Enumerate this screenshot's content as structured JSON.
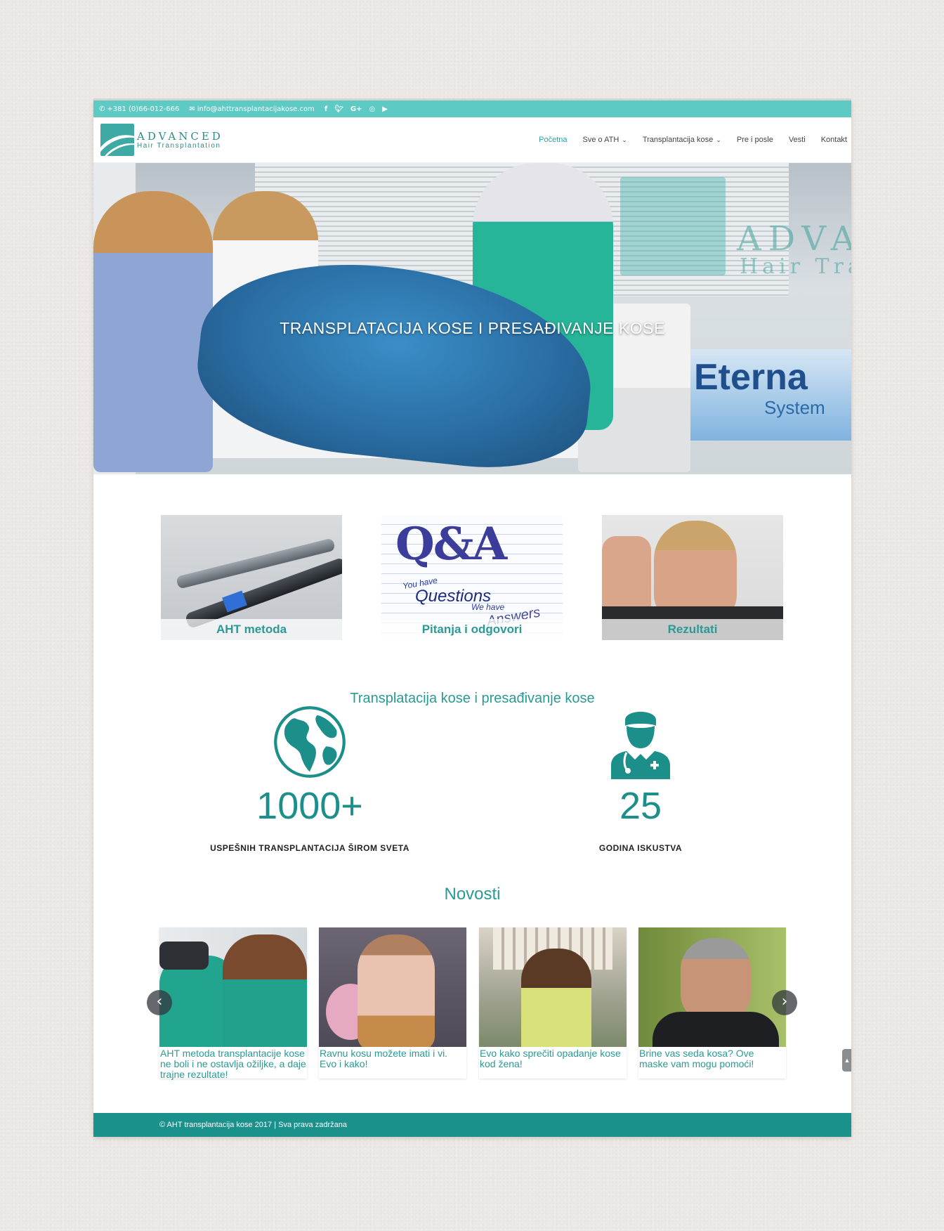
{
  "topbar": {
    "phone": "+381 (0)66-012-666",
    "email": "info@ahttransplantacijakose.com",
    "social": [
      "facebook-icon",
      "twitter-icon",
      "google-plus-icon",
      "instagram-icon",
      "youtube-icon"
    ]
  },
  "brand": {
    "line1": "ADVANCED",
    "line2": "Hair Transplantation"
  },
  "nav": {
    "items": [
      {
        "label": "Početna",
        "active": true
      },
      {
        "label": "Sve o ATH",
        "dropdown": true
      },
      {
        "label": "Transplantacija kose",
        "dropdown": true
      },
      {
        "label": "Pre i posle"
      },
      {
        "label": "Vesti"
      },
      {
        "label": "Kontakt"
      }
    ]
  },
  "hero": {
    "title": "TRANSPLATACIJA KOSE I PRESAĐIVANJE KOSE",
    "bg_logo_line1": "ADVA",
    "bg_logo_line2": "Hair Trans",
    "banner_line1": "Eterna",
    "banner_line2": "System"
  },
  "cards": [
    {
      "label": "AHT metoda"
    },
    {
      "label": "Pitanja i odgovori",
      "art": {
        "big": "Q&A",
        "l1": "You have",
        "l2": "Questions",
        "l3": "We have",
        "l4": "Answers"
      }
    },
    {
      "label": "Rezultati"
    }
  ],
  "stats": {
    "title": "Transplatacija kose i presađivanje kose",
    "left": {
      "number": "1000+",
      "caption": "USPEŠNIH TRANSPLANTACIJA ŠIROM SVETA"
    },
    "right": {
      "number": "25",
      "caption": "GODINA ISKUSTVA"
    }
  },
  "news": {
    "title": "Novosti",
    "items": [
      {
        "title": "AHT metoda transplantacije kose ne boli i ne ostavlja ožiljke, a daje trajne rezultate!"
      },
      {
        "title": "Ravnu kosu možete imati i vi. Evo i kako!"
      },
      {
        "title": "Evo kako sprečiti opadanje kose kod žena!"
      },
      {
        "title": "Brine vas seda kosa? Ove maske vam mogu pomoći!"
      }
    ]
  },
  "footer": {
    "text": "© AHT transplantacija kose 2017 | Sva prava zadržana"
  },
  "colors": {
    "accent": "#5ecac4",
    "brand": "#2a9a95",
    "footer": "#1a918b"
  }
}
